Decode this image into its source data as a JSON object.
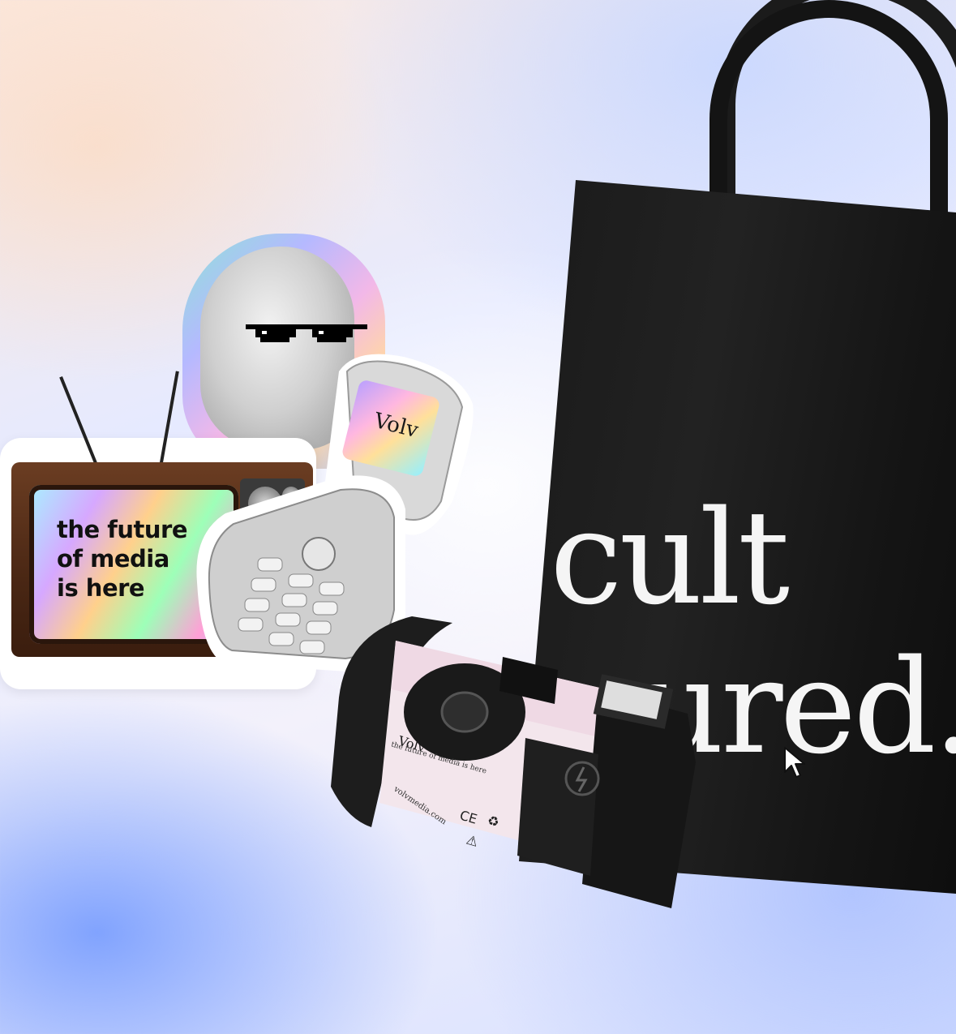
{
  "tote": {
    "line1": "cult",
    "line2": "ured."
  },
  "tv_sticker": {
    "line1": "the future",
    "line2": "of media",
    "line3": "is here"
  },
  "phone": {
    "screen_logo": "Volv"
  },
  "camera": {
    "brand": "Volv",
    "tagline": "the future of media is here",
    "url": "volvmedia.com"
  },
  "colors": {
    "tote": "#141414",
    "tote_text": "#f5f5f5",
    "tv_wood": "#4a2714"
  },
  "icons": [
    "cursor-arrow-icon",
    "sunglasses-icon",
    "flash-icon"
  ]
}
